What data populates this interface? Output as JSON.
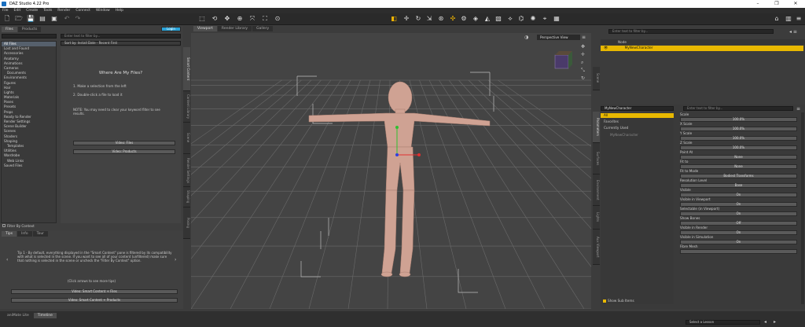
{
  "window": {
    "title": "DAZ Studio 4.22 Pro"
  },
  "menu": [
    "File",
    "Edit",
    "Create",
    "Tools",
    "Render",
    "Connect",
    "Window",
    "Help"
  ],
  "left_tabs": [
    "Files",
    "Products"
  ],
  "login_label": "Login",
  "search_placeholder": "Enter text to filter by...",
  "sort_label": "Sort by: Install Date - Recent First",
  "file_tree": [
    "All Files",
    "Lost and Found",
    "Accessories",
    "Anatomy",
    "Animations",
    "Cameras",
    "Documents",
    "Environments",
    "Figures",
    "Hair",
    "Lights",
    "Materials",
    "Poses",
    "Presets",
    "Props",
    "Ready to Render",
    "Render Settings",
    "Scene Builder",
    "Scenes",
    "Shaders",
    "Shaping",
    "Templates",
    "Utilities",
    "Wardrobe",
    "Web Links",
    "Saved Files"
  ],
  "filter_by_context": "Filter By Context",
  "where_files": {
    "heading": "Where Are My Files?",
    "step1": "1. Make a selection from the left",
    "step2": "2. Double-click a file to load it",
    "note": "NOTE: You may need to clear your keyword filter to see results.",
    "video1": "Video: Files",
    "video2": "Video: Products"
  },
  "left_vtabs": [
    "Smart Content",
    "Content Library",
    "Scene",
    "Render Settings",
    "Shaping",
    "Posing"
  ],
  "tips_tabs": [
    "Tips",
    "Info",
    "Tour"
  ],
  "tip_text": "Tip 1 - By default, everything displayed in the \"Smart Content\" pane is filtered by its compatibility with what is selected in the scene. If you want to see all of your content (unfiltered) make sure that nothing is selected in the scene or uncheck the \"Filter By Context\" option.",
  "tip_more": "(Click arrows to see more tips)",
  "tip_video1": "Video: Smart Content + Files",
  "tip_video2": "Video: Smart Content + Products",
  "viewport_tabs": [
    "Viewport",
    "Render Library",
    "Gallery"
  ],
  "perspective": "Perspective View",
  "scene_search": "Enter text to filter by...",
  "scene_header": "Node",
  "scene_item": "MyNewCharacter",
  "right_vtabs": [
    "Scene",
    "Parameters",
    "Surfaces",
    "Environment",
    "Lights",
    "Aux Viewport"
  ],
  "param_node": "MyNewCharacter",
  "param_categories": [
    "All",
    "Favorites",
    "Currently Used"
  ],
  "param_tree": [
    "MyNewCharacter"
  ],
  "show_sub_items": "Show Sub Items",
  "properties": [
    {
      "label": "Scale",
      "value": "100.0%"
    },
    {
      "label": "X Scale",
      "value": "100.0%"
    },
    {
      "label": "Y Scale",
      "value": "100.0%"
    },
    {
      "label": "Z Scale",
      "value": "100.0%"
    },
    {
      "label": "Point At",
      "value": "None"
    },
    {
      "label": "Fit to",
      "value": "None"
    },
    {
      "label": "Fit to Mode",
      "value": "Bodiest Transforms"
    },
    {
      "label": "Resolution Level",
      "value": "Base"
    },
    {
      "label": "Visible",
      "value": "On"
    },
    {
      "label": "Visible in Viewport",
      "value": "On"
    },
    {
      "label": "Selectable (in Viewport)",
      "value": "On"
    },
    {
      "label": "Show Bones",
      "value": "Off"
    },
    {
      "label": "Visible in Render",
      "value": "On"
    },
    {
      "label": "Visible in Simulation",
      "value": "On"
    },
    {
      "label": "Fibre Mesh",
      "value": ""
    }
  ],
  "bottom_tabs": [
    "aniMate Lite",
    "Timeline"
  ],
  "lesson_select": "Select a Lesson"
}
